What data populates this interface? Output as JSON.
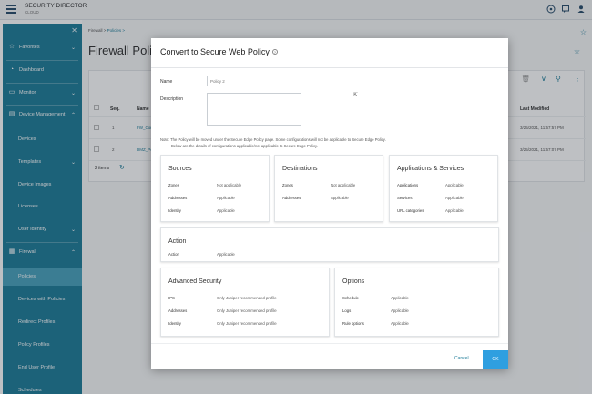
{
  "app": {
    "title": "SECURITY DIRECTOR",
    "subtitle": "CLOUD"
  },
  "topbar": {
    "icons": [
      "info-icon",
      "chat-icon",
      "user-icon"
    ]
  },
  "sidebar": {
    "items": [
      {
        "label": "Favorites",
        "icon": "star-icon",
        "type": "section"
      },
      {
        "label": "Dashboard",
        "icon": "dashboard-icon",
        "type": "section"
      },
      {
        "label": "Monitor",
        "icon": "monitor-icon",
        "type": "section"
      },
      {
        "label": "Device Management",
        "icon": "device-icon",
        "type": "section"
      },
      {
        "label": "Devices",
        "type": "sub"
      },
      {
        "label": "Templates",
        "type": "sub"
      },
      {
        "label": "Device Images",
        "type": "sub"
      },
      {
        "label": "Licenses",
        "type": "sub"
      },
      {
        "label": "User Identity",
        "type": "sub"
      },
      {
        "label": "Firewall",
        "icon": "firewall-icon",
        "type": "section"
      },
      {
        "label": "Policies",
        "type": "sub",
        "active": true
      },
      {
        "label": "Devices with Policies",
        "type": "sub"
      },
      {
        "label": "Redirect Profiles",
        "type": "sub"
      },
      {
        "label": "Policy Profiles",
        "type": "sub"
      },
      {
        "label": "End User Profile",
        "type": "sub"
      },
      {
        "label": "Schedules",
        "type": "sub"
      }
    ]
  },
  "page": {
    "breadcrumb_root": "Firewall >",
    "breadcrumb_current": "Policies >",
    "title": "Firewall Policy",
    "table": {
      "headers": {
        "seq": "Seq.",
        "name": "Name",
        "last_modified": "Last Modified"
      },
      "rows": [
        {
          "seq": "1",
          "name": "FW_Cor",
          "last_modified": "3/25/2021, 11:57:57 PM"
        },
        {
          "seq": "2",
          "name": "DMZ_Po",
          "last_modified": "3/25/2021, 11:57:07 PM"
        }
      ],
      "count": "2 items"
    }
  },
  "modal": {
    "title": "Convert to Secure Web Policy",
    "name_label": "Name",
    "name_value": "Policy 2",
    "description_label": "Description",
    "note_line1": "Note:  The Policy will be moved under the Secure Edge Policy page. Some configurations will not be applicable to Secure Edge Policy.",
    "note_line2": "Below are the details of configurations applicable/not applicable to Secure Edge Policy.",
    "sources": {
      "title": "Sources",
      "rows": [
        {
          "key": "Zones",
          "value": "Not applicable"
        },
        {
          "key": "Addresses",
          "value": "Applicable"
        },
        {
          "key": "Identity",
          "value": "Applicable"
        }
      ]
    },
    "destinations": {
      "title": "Destinations",
      "rows": [
        {
          "key": "Zones",
          "value": "Not applicable"
        },
        {
          "key": "Addresses",
          "value": "Applicable"
        }
      ]
    },
    "apps": {
      "title": "Applications & Services",
      "rows": [
        {
          "key": "Applications",
          "value": "Applicable"
        },
        {
          "key": "Services",
          "value": "Applicable"
        },
        {
          "key": "URL categories",
          "value": "Applicable"
        }
      ]
    },
    "action": {
      "title": "Action",
      "rows": [
        {
          "key": "Action",
          "value": "Applicable"
        }
      ]
    },
    "advanced": {
      "title": "Advanced Security",
      "rows": [
        {
          "key": "IPS",
          "value": "Only Juniper recommended profile"
        },
        {
          "key": "Addresses",
          "value": "Only Juniper recommended profile"
        },
        {
          "key": "Identity",
          "value": "Only Juniper recommended profile"
        }
      ]
    },
    "options": {
      "title": "Options",
      "rows": [
        {
          "key": "Schedule",
          "value": "Applicable"
        },
        {
          "key": "Logs",
          "value": "Applicable"
        },
        {
          "key": "Rule options",
          "value": "Applicable"
        }
      ]
    },
    "cancel_label": "Cancel",
    "ok_label": "OK"
  },
  "colors": {
    "sidebar": "#1f7d99",
    "sidebar_active": "#4aa3bd",
    "primary_button": "#2f9fe0"
  }
}
